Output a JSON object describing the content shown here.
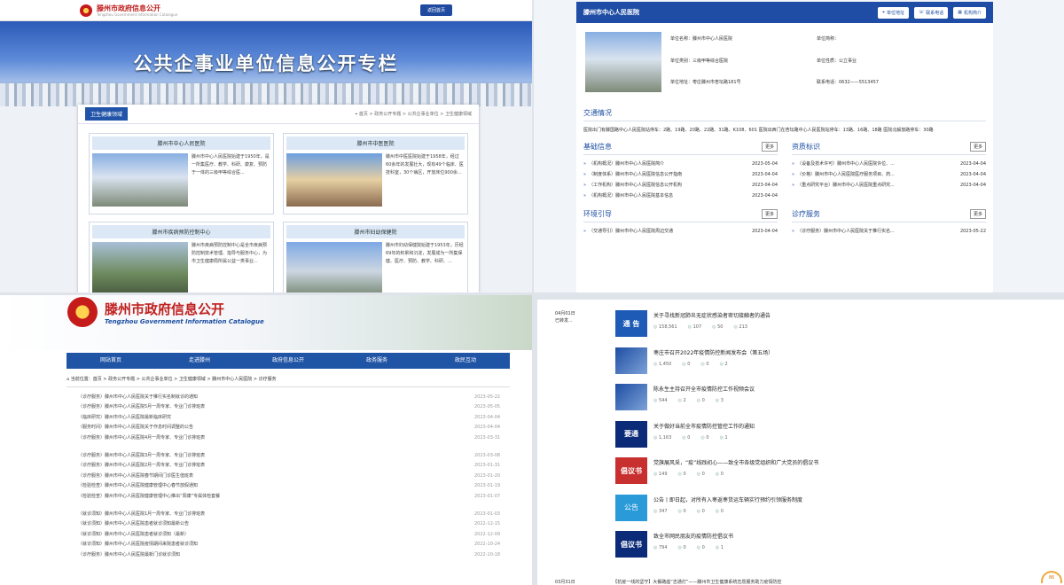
{
  "q1": {
    "logo": "滕州市政府信息公开",
    "logo_sub": "Tengzhou Government Information Catalogue",
    "home_btn": "返回首页",
    "hero_title": "公共企事业单位信息公开专栏",
    "tab": "卫生健康领域",
    "breadcrumb": "首页 > 政务公开专题 > 公共企事业单位 > 卫生健康领域",
    "cards": [
      {
        "title": "滕州市中心人民医院",
        "desc": "滕州市中心人民医院始建于1950年，是一所集医疗、教学、科研、康复、预防于一体的三级甲等综合医..."
      },
      {
        "title": "滕州市中医医院",
        "desc": "滕州市中医医院始建于1958年，经过60余年的发展壮大，现有49个临床、医技科室，30个病区，开放床位900余..."
      },
      {
        "title": "滕州市疾病预防控制中心",
        "desc": "滕州市疾病预防控制中心是全市疾病预防控制技术管理、指导与服务中心，为市卫生健康局所属公益一类事业..."
      },
      {
        "title": "滕州市妇幼保健院",
        "desc": "滕州市妇幼保健院始建于1953年，历经69年的积累和沉淀，发展成为一所集保健、医疗、预防、教学、科研、..."
      }
    ]
  },
  "q2": {
    "hospital": "滕州市中心人民医院",
    "btn_addr": "单位地址",
    "btn_phone": "联系电话",
    "btn_intro": "机构简介",
    "fields": [
      "单位名称：滕州市中心人民医院",
      "单位简称：",
      "单位类别：三级甲等综合医院",
      "单位性质：公立事业",
      "单位地址：枣庄滕州市杏坛路181号",
      "联系电话：0632——5513457"
    ],
    "traffic_title": "交通情况",
    "traffic_text": "医院出门有滕国路中心人民医院站停车：2路、19路、20路、22路、31路、K108、601 医院出西门在杏坛路中心人民医院站停车：13路、16路、18路 医院北解放路停车：30路",
    "more": "更多",
    "sections": [
      {
        "title": "基础信息",
        "items": [
          {
            "text": "（机构概况）滕州市中心人民医院简介",
            "date": "2023-05-04"
          },
          {
            "text": "（制度体系）滕州市中心人民医院信息公开指南",
            "date": "2023-04-04"
          },
          {
            "text": "（工作机构）滕州市中心人民医院信息公开机构",
            "date": "2023-04-04"
          },
          {
            "text": "（机构概况）滕州市中心人民医院基本信息",
            "date": "2023-04-04"
          }
        ]
      },
      {
        "title": "资质标识",
        "items": [
          {
            "text": "（设备及技术许可）滕州市中心人民医院许位、...",
            "date": "2023-04-04"
          },
          {
            "text": "（价格）滕州市中心人民医院医疗服务项目、药...",
            "date": "2023-04-04"
          },
          {
            "text": "（重点研究平台）滕州市中心人民医院重点研究...",
            "date": "2023-04-04"
          }
        ]
      },
      {
        "title": "环境引导",
        "items": [
          {
            "text": "（交通导引）滕州市中心人民医院周边交通",
            "date": "2023-04-04"
          }
        ]
      },
      {
        "title": "诊疗服务",
        "items": [
          {
            "text": "（诊疗服务）滕州市中心人民医院关于推行实名...",
            "date": "2023-05-22"
          }
        ]
      }
    ]
  },
  "q3": {
    "title": "滕州市政府信息公开",
    "subtitle": "Tengzhou Government Information Catalogue",
    "nav": [
      "网站首页",
      "走进滕州",
      "政府信息公开",
      "政务服务",
      "政民互动"
    ],
    "location": "当前位置：首页 > 政务公开专题 > 公共企事业单位 > 卫生健康领域 > 滕州市中心人民医院 > 诊疗服务",
    "groups": [
      [
        {
          "text": "（诊疗服务）滕州市中心人民医院关于推行实名制就诊的通知",
          "date": "2023-05-22"
        },
        {
          "text": "（诊疗服务）滕州市中心人民医院5月一周专家、专业门诊排班表",
          "date": "2023-05-05"
        },
        {
          "text": "（临床研究）滕州市中心人民医院最新临床研究",
          "date": "2023-04-04"
        },
        {
          "text": "（服务时间）滕州市中心人民医院关于作息时间调整的公告",
          "date": "2023-04-04"
        },
        {
          "text": "（诊疗服务）滕州市中心人民医院4月一周专家、专业门诊排班表",
          "date": "2023-03-31"
        }
      ],
      [
        {
          "text": "（诊疗服务）滕州市中心人民医院3月一周专家、专业门诊排班表",
          "date": "2023-03-08"
        },
        {
          "text": "（诊疗服务）滕州市中心人民医院2月一周专家、专业门诊排班表",
          "date": "2023-01-31"
        },
        {
          "text": "（诊疗服务）滕州市中心人民医院春节期间门诊医生值班表",
          "date": "2023-01-20"
        },
        {
          "text": "（检验检查）滕州市中心人民医院健康管理中心春节放假通知",
          "date": "2023-01-19"
        },
        {
          "text": "（检验检查）滕州市中心人民医院健康管理中心推出“阳康”专属体检套餐",
          "date": "2023-01-07"
        }
      ],
      [
        {
          "text": "（就诊须知）滕州市中心人民医院1月一周专家、专业门诊排班表",
          "date": "2023-01-03"
        },
        {
          "text": "（就诊须知）滕州市中心人民医院患者就诊须知最新公告",
          "date": "2022-12-15"
        },
        {
          "text": "（就诊须知）滕州市中心人民医院患者就诊须知（最新）",
          "date": "2022-12-09"
        },
        {
          "text": "（就诊须知）滕州市中心人民医院疫情期间来院患者就诊须知",
          "date": "2022-10-24"
        },
        {
          "text": "（诊疗服务）滕州市中心人民医院最新门诊就诊须知",
          "date": "2022-10-18"
        }
      ]
    ]
  },
  "q4": {
    "date": "04月01日",
    "date_sub": "已转发...",
    "items": [
      {
        "thumb": "通 告",
        "style": "",
        "title": "关于寻找新冠肺炎无症状感染者密切接触者的通告",
        "stats": [
          "158,561",
          "107",
          "50",
          "213"
        ]
      },
      {
        "thumb": "",
        "style": "p",
        "title": "枣庄市召开2022年疫情防控新闻发布会（第五场）",
        "stats": [
          "1,450",
          "0",
          "0",
          "2"
        ]
      },
      {
        "thumb": "",
        "style": "p",
        "title": "陈永生主持召开全市疫情防控工作视频会议",
        "stats": [
          "544",
          "2",
          "0",
          "3"
        ]
      },
      {
        "thumb": "要通",
        "style": "n",
        "title": "关于做好当前全市疫情防控管控工作的通知",
        "stats": [
          "1,163",
          "0",
          "0",
          "1"
        ]
      },
      {
        "thumb": "倡议书",
        "style": "r",
        "title": "党旗展风采，“疫”线践初心——致全市各级党组织和广大党员的倡议书",
        "stats": [
          "149",
          "0",
          "0",
          "0"
        ]
      },
      {
        "thumb": "公告",
        "style": "c",
        "title": "公告丨即日起，对所有入枣返枣货运车辆实行预约引领服务制度",
        "stats": [
          "347",
          "0",
          "0",
          "0"
        ]
      },
      {
        "thumb": "倡议书",
        "style": "n",
        "title": "致全市网民朋友的疫情防控倡议书",
        "stats": [
          "794",
          "0",
          "0",
          "1"
        ]
      }
    ],
    "footer_date": "03月31日",
    "footer_title": "【抗疫一线的坚守】大餐路座“志通灯”——滕州市卫生健康系统志愿服务助力疫情防控",
    "badge": "86"
  }
}
